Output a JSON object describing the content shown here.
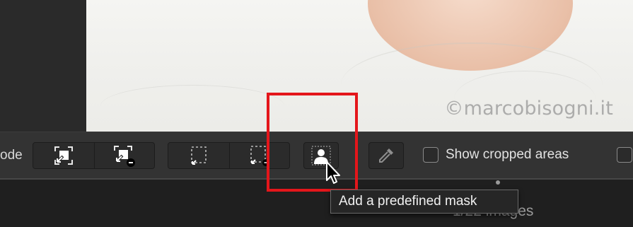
{
  "photo": {
    "watermark": "©marcobisogni.it"
  },
  "toolbar": {
    "mode_label": "ode",
    "group1": [
      {
        "icon": "add-selection-icon"
      },
      {
        "icon": "subtract-selection-icon"
      }
    ],
    "group2": [
      {
        "icon": "dashed-add-selection-icon"
      },
      {
        "icon": "dashed-subtract-selection-icon"
      }
    ],
    "mask_button_icon": "person-mask-icon",
    "eyedropper_icon": "eyedropper-icon",
    "show_cropped_label": "Show cropped areas",
    "show_cropped_checked": false
  },
  "tooltip": {
    "text": "Add a predefined mask"
  },
  "footer": {
    "image_count": "1/22 images"
  },
  "colors": {
    "highlight": "#e4161b",
    "toolbar_bg": "#333333",
    "button_bg": "#2b2b2b"
  }
}
